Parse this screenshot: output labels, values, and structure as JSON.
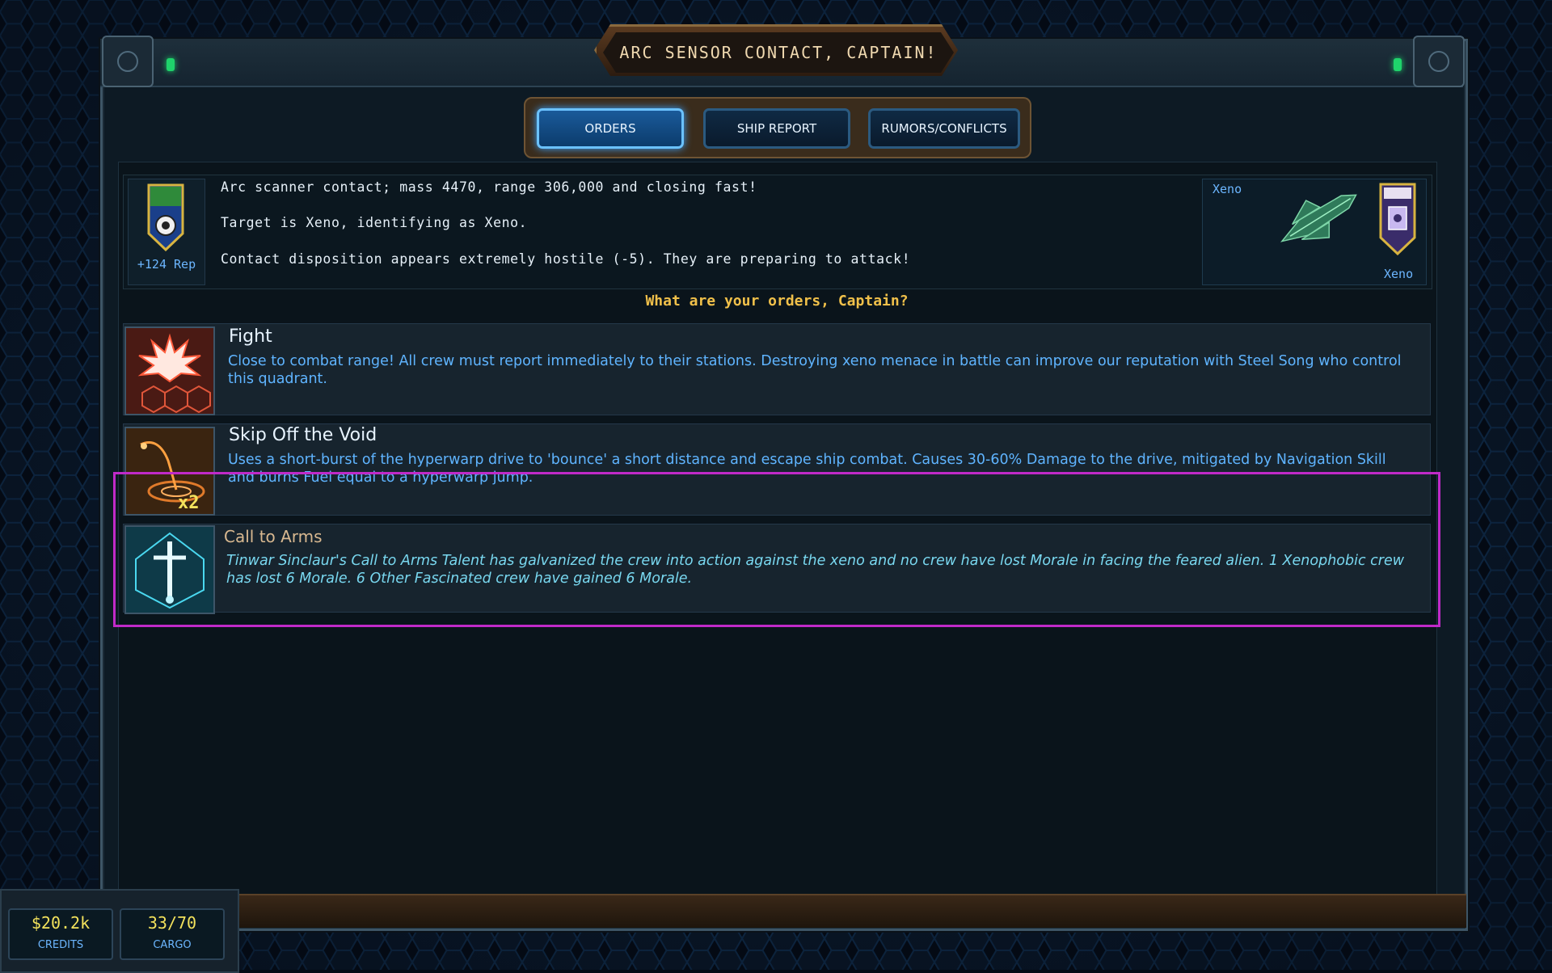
{
  "window": {
    "title": "ARC SENSOR CONTACT, CAPTAIN!"
  },
  "tabs": [
    {
      "label": "ORDERS",
      "active": true
    },
    {
      "label": "SHIP REPORT",
      "active": false
    },
    {
      "label": "RUMORS/CONFLICTS",
      "active": false
    }
  ],
  "contact": {
    "rep_label": "+124 Rep",
    "lines": [
      "Arc scanner contact; mass 4470, range 306,000 and closing fast!",
      "Target is Xeno, identifying as Xeno.",
      "Contact disposition appears extremely hostile (-5). They are preparing to attack!"
    ],
    "enemy_name_top": "Xeno",
    "enemy_name_bottom": "Xeno"
  },
  "prompt": "What are your orders, Captain?",
  "options": [
    {
      "title": "Fight",
      "description": "Close to combat range! All crew must report immediately to their stations. Destroying xeno menace in battle can improve our reputation with Steel Song who control this quadrant.",
      "icon": "combat-burst-icon"
    },
    {
      "title": "Skip Off the Void",
      "description": "Uses a short-burst of the hyperwarp drive to 'bounce' a short distance and escape ship combat. Causes 30-60% Damage to the drive, mitigated by Navigation Skill and burns Fuel equal to a hyperwarp jump.",
      "icon": "hyperwarp-bounce-icon",
      "badge": "x2"
    },
    {
      "title": "Call to Arms",
      "description": "Tinwar Sinclaur's Call to Arms Talent has galvanized the crew into action against the xeno and no crew have lost Morale in facing the feared alien. 1 Xenophobic crew has lost 6 Morale. 6 Other Fascinated crew have gained 6 Morale.",
      "icon": "sword-emblem-icon"
    }
  ],
  "status": {
    "credits_value": "$20.2k",
    "credits_label": "CREDITS",
    "cargo_value": "33/70",
    "cargo_label": "CARGO"
  },
  "colors": {
    "accent": "#6bc2ff",
    "highlight": "#c02ac8",
    "prompt": "#f0c04a"
  }
}
